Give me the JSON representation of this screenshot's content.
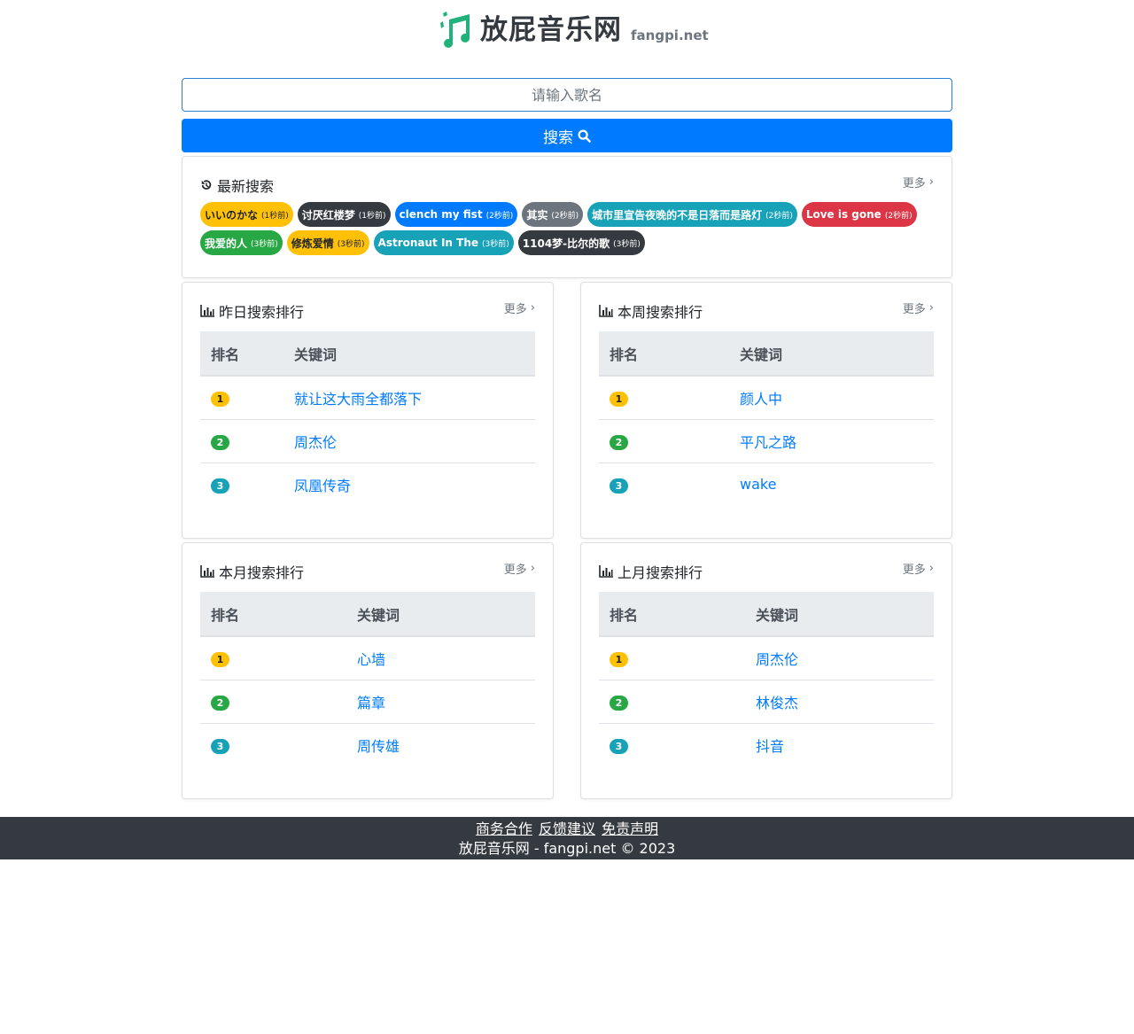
{
  "brand": {
    "title": "放屁音乐网",
    "subtitle": "fangpi.net",
    "logo_icon": "music-note-icon",
    "logo_color": "#20b27a"
  },
  "search": {
    "placeholder": "请输入歌名",
    "button_label": "搜索",
    "button_icon": "search-icon",
    "button_color": "#007bff"
  },
  "latest": {
    "title": "最新搜索",
    "icon": "history-icon",
    "more_label": "更多",
    "tags": [
      {
        "text": "いいのかな",
        "time": "(1秒前)",
        "color": "#ffc107"
      },
      {
        "text": "讨厌红楼梦",
        "time": "(1秒前)",
        "color": "#343a40"
      },
      {
        "text": "clench my fist",
        "time": "(2秒前)",
        "color": "#007bff"
      },
      {
        "text": "其实",
        "time": "(2秒前)",
        "color": "#6c757d"
      },
      {
        "text": "城市里宣告夜晚的不是日落而是路灯",
        "time": "(2秒前)",
        "color": "#17a2b8"
      },
      {
        "text": "Love is gone",
        "time": "(2秒前)",
        "color": "#dc3545"
      },
      {
        "text": "我爱的人",
        "time": "(3秒前)",
        "color": "#28a745"
      },
      {
        "text": "修炼爱情",
        "time": "(3秒前)",
        "color": "#ffc107"
      },
      {
        "text": "Astronaut In The",
        "time": "(3秒前)",
        "color": "#17a2b8"
      },
      {
        "text": "1104梦-比尔的歌",
        "time": "(3秒前)",
        "color": "#343a40"
      }
    ]
  },
  "rankings": [
    {
      "title": "昨日搜索排行",
      "icon": "bar-chart-icon",
      "more_label": "更多",
      "col_rank": "排名",
      "col_keyword": "关键词",
      "rows": [
        {
          "rank": "1",
          "keyword": "就让这大雨全都落下"
        },
        {
          "rank": "2",
          "keyword": "周杰伦"
        },
        {
          "rank": "3",
          "keyword": "凤凰传奇"
        }
      ]
    },
    {
      "title": "本周搜索排行",
      "icon": "bar-chart-icon",
      "more_label": "更多",
      "col_rank": "排名",
      "col_keyword": "关键词",
      "rows": [
        {
          "rank": "1",
          "keyword": "颜人中"
        },
        {
          "rank": "2",
          "keyword": "平凡之路"
        },
        {
          "rank": "3",
          "keyword": "wake"
        }
      ]
    },
    {
      "title": "本月搜索排行",
      "icon": "bar-chart-icon",
      "more_label": "更多",
      "col_rank": "排名",
      "col_keyword": "关键词",
      "rows": [
        {
          "rank": "1",
          "keyword": "心墙"
        },
        {
          "rank": "2",
          "keyword": "篇章"
        },
        {
          "rank": "3",
          "keyword": "周传雄"
        }
      ]
    },
    {
      "title": "上月搜索排行",
      "icon": "bar-chart-icon",
      "more_label": "更多",
      "col_rank": "排名",
      "col_keyword": "关键词",
      "rows": [
        {
          "rank": "1",
          "keyword": "周杰伦"
        },
        {
          "rank": "2",
          "keyword": "林俊杰"
        },
        {
          "rank": "3",
          "keyword": "抖音"
        }
      ]
    }
  ],
  "footer": {
    "links": [
      "商务合作",
      "反馈建议",
      "免责声明"
    ],
    "copyright": "放屁音乐网 - fangpi.net © 2023",
    "background": "#343a40"
  }
}
